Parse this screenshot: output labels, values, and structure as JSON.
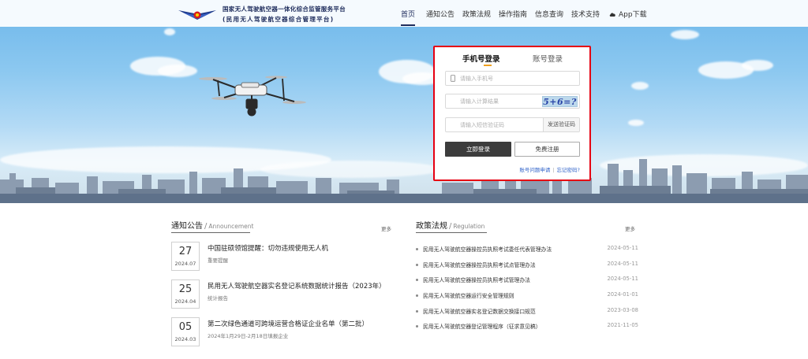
{
  "header": {
    "logo_line1": "国家无人驾驶航空器一体化综合监管服务平台",
    "logo_line2": "(民用无人驾驶航空器综合管理平台)",
    "nav": [
      "首页",
      "通知公告",
      "政策法规",
      "操作指南",
      "信息查询",
      "技术支持",
      "App下载"
    ],
    "active_nav": "首页"
  },
  "login": {
    "tab_phone": "手机号登录",
    "tab_account": "账号登录",
    "phone_placeholder": "请输入手机号",
    "calc_placeholder": "请输入计算结果",
    "captcha_text": "5+6=?",
    "sms_placeholder": "请输入短信验证码",
    "sms_button": "发送验证码",
    "login_button": "立即登录",
    "register_button": "免费注册",
    "link_problem": "账号问题申请",
    "link_forgot": "忘记密码?"
  },
  "notices": {
    "title": "通知公告",
    "subtitle": "Announcement",
    "more": "更多",
    "items": [
      {
        "day": "27",
        "month": "2024.07",
        "title": "中国驻硕领馆提醒：切勿违规使用无人机",
        "tag": "重要提醒"
      },
      {
        "day": "25",
        "month": "2024.04",
        "title": "民用无人驾驶航空器实名登记系统数据统计报告（2023年）",
        "tag": "统计报告"
      },
      {
        "day": "05",
        "month": "2024.03",
        "title": "第二次绿色通道可跨境运营合格证企业名单（第二批）",
        "tag": "2024年1月29日-2月18日填报企业"
      }
    ]
  },
  "regulations": {
    "title": "政策法规",
    "subtitle": "Regulation",
    "more": "更多",
    "items": [
      {
        "title": "民用无人驾驶航空器操控员执照考试委任代表管理办法",
        "date": "2024-05-11"
      },
      {
        "title": "民用无人驾驶航空器操控员执照考试点管理办法",
        "date": "2024-05-11"
      },
      {
        "title": "民用无人驾驶航空器操控员执照考试管理办法",
        "date": "2024-05-11"
      },
      {
        "title": "民用无人驾驶航空器运行安全管理规则",
        "date": "2024-01-01"
      },
      {
        "title": "民用无人驾驶航空器实名登记数据交换接口规范",
        "date": "2023-03-08"
      },
      {
        "title": "民用无人驾驶航空器登记管理程序（征求意见稿）",
        "date": "2021-11-05"
      }
    ]
  },
  "colors": {
    "brand": "#1e2c5c",
    "highlight": "#e60012",
    "tab_accent": "#f0a020",
    "link": "#2f62c9"
  }
}
